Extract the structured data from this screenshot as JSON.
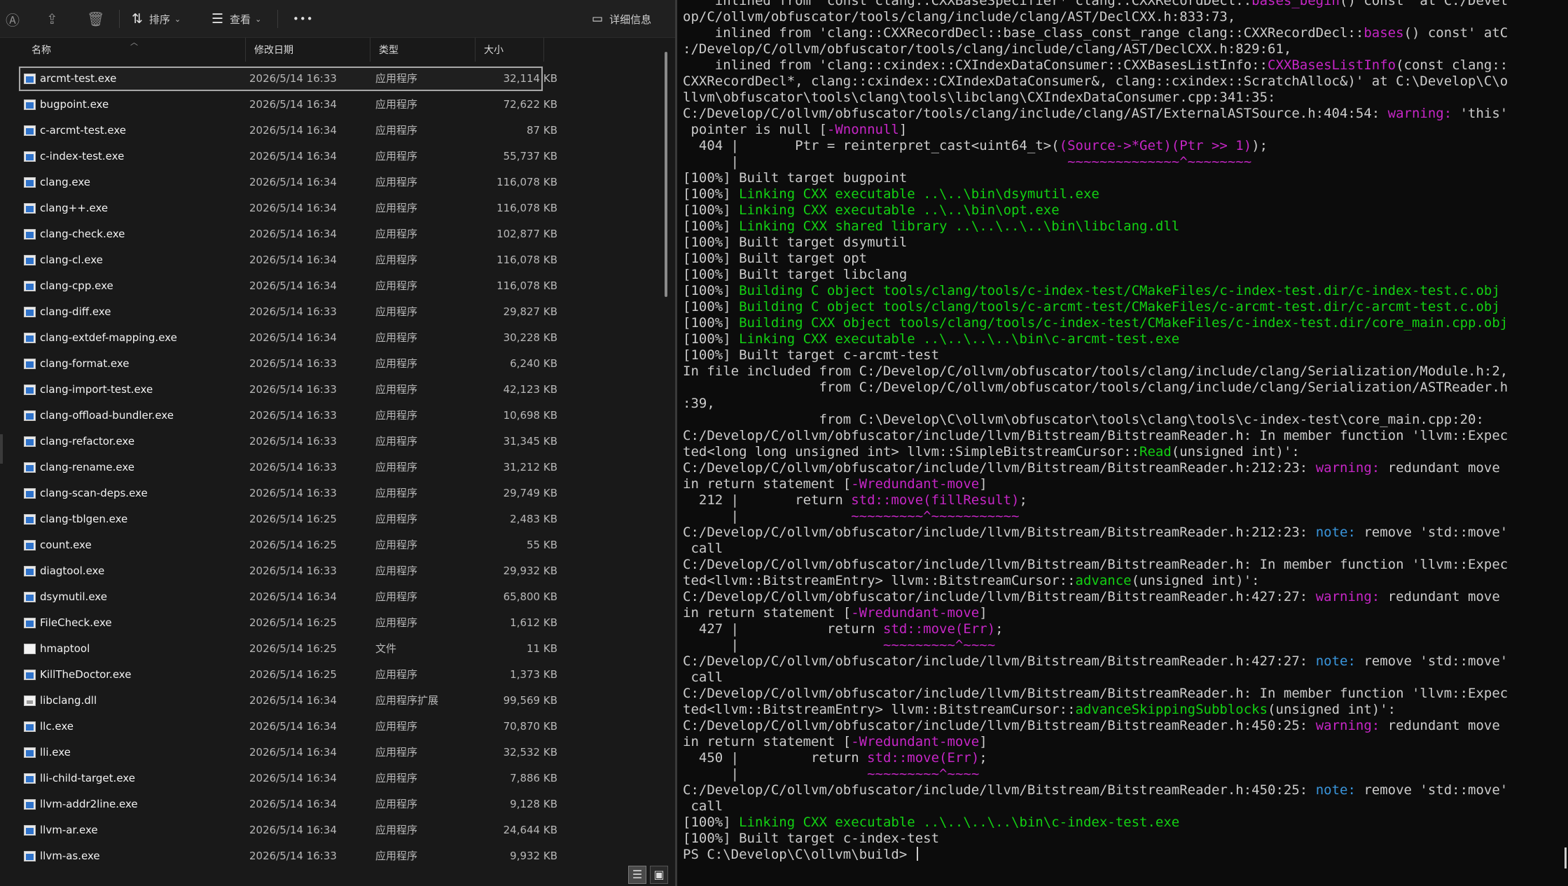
{
  "explorer": {
    "toolbar": {
      "sort_label": "排序",
      "view_label": "查看",
      "more_label": "•••",
      "details_label": "详细信息"
    },
    "columns": {
      "name": "名称",
      "modified": "修改日期",
      "type": "类型",
      "size": "大小"
    },
    "files": [
      {
        "name": "arcmt-test.exe",
        "date": "2026/5/14 16:33",
        "type": "应用程序",
        "size": "32,114 KB",
        "icon": "exe-icon",
        "selected": true
      },
      {
        "name": "bugpoint.exe",
        "date": "2026/5/14 16:34",
        "type": "应用程序",
        "size": "72,622 KB",
        "icon": "exe-icon"
      },
      {
        "name": "c-arcmt-test.exe",
        "date": "2026/5/14 16:34",
        "type": "应用程序",
        "size": "87 KB",
        "icon": "exe-icon"
      },
      {
        "name": "c-index-test.exe",
        "date": "2026/5/14 16:34",
        "type": "应用程序",
        "size": "55,737 KB",
        "icon": "exe-icon"
      },
      {
        "name": "clang.exe",
        "date": "2026/5/14 16:34",
        "type": "应用程序",
        "size": "116,078 KB",
        "icon": "exe-icon"
      },
      {
        "name": "clang++.exe",
        "date": "2026/5/14 16:34",
        "type": "应用程序",
        "size": "116,078 KB",
        "icon": "exe-icon"
      },
      {
        "name": "clang-check.exe",
        "date": "2026/5/14 16:34",
        "type": "应用程序",
        "size": "102,877 KB",
        "icon": "exe-icon"
      },
      {
        "name": "clang-cl.exe",
        "date": "2026/5/14 16:34",
        "type": "应用程序",
        "size": "116,078 KB",
        "icon": "exe-icon"
      },
      {
        "name": "clang-cpp.exe",
        "date": "2026/5/14 16:34",
        "type": "应用程序",
        "size": "116,078 KB",
        "icon": "exe-icon"
      },
      {
        "name": "clang-diff.exe",
        "date": "2026/5/14 16:33",
        "type": "应用程序",
        "size": "29,827 KB",
        "icon": "exe-icon"
      },
      {
        "name": "clang-extdef-mapping.exe",
        "date": "2026/5/14 16:34",
        "type": "应用程序",
        "size": "30,228 KB",
        "icon": "exe-icon"
      },
      {
        "name": "clang-format.exe",
        "date": "2026/5/14 16:33",
        "type": "应用程序",
        "size": "6,240 KB",
        "icon": "exe-icon"
      },
      {
        "name": "clang-import-test.exe",
        "date": "2026/5/14 16:33",
        "type": "应用程序",
        "size": "42,123 KB",
        "icon": "exe-icon"
      },
      {
        "name": "clang-offload-bundler.exe",
        "date": "2026/5/14 16:33",
        "type": "应用程序",
        "size": "10,698 KB",
        "icon": "exe-icon"
      },
      {
        "name": "clang-refactor.exe",
        "date": "2026/5/14 16:33",
        "type": "应用程序",
        "size": "31,345 KB",
        "icon": "exe-icon"
      },
      {
        "name": "clang-rename.exe",
        "date": "2026/5/14 16:33",
        "type": "应用程序",
        "size": "31,212 KB",
        "icon": "exe-icon"
      },
      {
        "name": "clang-scan-deps.exe",
        "date": "2026/5/14 16:33",
        "type": "应用程序",
        "size": "29,749 KB",
        "icon": "exe-icon"
      },
      {
        "name": "clang-tblgen.exe",
        "date": "2026/5/14 16:25",
        "type": "应用程序",
        "size": "2,483 KB",
        "icon": "exe-icon"
      },
      {
        "name": "count.exe",
        "date": "2026/5/14 16:25",
        "type": "应用程序",
        "size": "55 KB",
        "icon": "exe-icon"
      },
      {
        "name": "diagtool.exe",
        "date": "2026/5/14 16:33",
        "type": "应用程序",
        "size": "29,932 KB",
        "icon": "exe-icon"
      },
      {
        "name": "dsymutil.exe",
        "date": "2026/5/14 16:34",
        "type": "应用程序",
        "size": "65,800 KB",
        "icon": "exe-icon"
      },
      {
        "name": "FileCheck.exe",
        "date": "2026/5/14 16:25",
        "type": "应用程序",
        "size": "1,612 KB",
        "icon": "exe-icon"
      },
      {
        "name": "hmaptool",
        "date": "2026/5/14 16:25",
        "type": "文件",
        "size": "11 KB",
        "icon": "file-icon"
      },
      {
        "name": "KillTheDoctor.exe",
        "date": "2026/5/14 16:25",
        "type": "应用程序",
        "size": "1,373 KB",
        "icon": "exe-icon"
      },
      {
        "name": "libclang.dll",
        "date": "2026/5/14 16:34",
        "type": "应用程序扩展",
        "size": "99,569 KB",
        "icon": "dll-icon"
      },
      {
        "name": "llc.exe",
        "date": "2026/5/14 16:34",
        "type": "应用程序",
        "size": "70,870 KB",
        "icon": "exe-icon"
      },
      {
        "name": "lli.exe",
        "date": "2026/5/14 16:34",
        "type": "应用程序",
        "size": "32,532 KB",
        "icon": "exe-icon"
      },
      {
        "name": "lli-child-target.exe",
        "date": "2026/5/14 16:34",
        "type": "应用程序",
        "size": "7,886 KB",
        "icon": "exe-icon"
      },
      {
        "name": "llvm-addr2line.exe",
        "date": "2026/5/14 16:34",
        "type": "应用程序",
        "size": "9,128 KB",
        "icon": "exe-icon"
      },
      {
        "name": "llvm-ar.exe",
        "date": "2026/5/14 16:34",
        "type": "应用程序",
        "size": "24,644 KB",
        "icon": "exe-icon"
      },
      {
        "name": "llvm-as.exe",
        "date": "2026/5/14 16:33",
        "type": "应用程序",
        "size": "9,932 KB",
        "icon": "exe-icon"
      }
    ]
  },
  "terminal": {
    "colors": {
      "green": "#13d113",
      "magenta": "#c626c6",
      "cyan": "#3a96dd",
      "text": "#cccccc",
      "background": "#0c0c0c"
    },
    "lines": [
      [
        {
          "t": "    inlined from 'const clang::CXXBaseSpecifier* clang::CXXRecordDecl::"
        },
        {
          "t": "bases_begin",
          "c": "c-mag"
        },
        {
          "t": "() const' at C:/Devel"
        }
      ],
      [
        {
          "t": "op/C/ollvm/obfuscator/tools/clang/include/clang/AST/DeclCXX.h:833:73,"
        }
      ],
      [
        {
          "t": "    inlined from 'clang::CXXRecordDecl::base_class_const_range clang::CXXRecordDecl::"
        },
        {
          "t": "bases",
          "c": "c-mag"
        },
        {
          "t": "() const' atC"
        }
      ],
      [
        {
          "t": ":/Develop/C/ollvm/obfuscator/tools/clang/include/clang/AST/DeclCXX.h:829:61,"
        }
      ],
      [
        {
          "t": "    inlined from 'clang::cxindex::CXIndexDataConsumer::CXXBasesListInfo::"
        },
        {
          "t": "CXXBasesListInfo",
          "c": "c-mag"
        },
        {
          "t": "(const clang::"
        }
      ],
      [
        {
          "t": "CXXRecordDecl*, clang::cxindex::CXIndexDataConsumer&, clang::cxindex::ScratchAlloc&)' at C:\\Develop\\C\\o"
        }
      ],
      [
        {
          "t": "llvm\\obfuscator\\tools\\clang\\tools\\libclang\\CXIndexDataConsumer.cpp:341:35:"
        }
      ],
      [
        {
          "t": "C:/Develop/C/ollvm/obfuscator/tools/clang/include/clang/AST/ExternalASTSource.h:404:54: "
        },
        {
          "t": "warning:",
          "c": "c-mag"
        },
        {
          "t": " 'this'"
        }
      ],
      [
        {
          "t": " pointer is null ["
        },
        {
          "t": "-Wnonnull",
          "c": "c-mag"
        },
        {
          "t": "]"
        }
      ],
      [
        {
          "t": "  404 |       Ptr = reinterpret_cast<uint64_t>("
        },
        {
          "t": "(Source->*Get)(Ptr >> 1)",
          "c": "c-mag"
        },
        {
          "t": ");"
        }
      ],
      [
        {
          "t": "      |                                         "
        },
        {
          "t": "~~~~~~~~~~~~~~^~~~~~~~~",
          "c": "c-mag"
        }
      ],
      [
        {
          "t": "[100%] Built target bugpoint"
        }
      ],
      [
        {
          "t": "[100%] "
        },
        {
          "t": "Linking CXX executable ..\\..\\bin\\dsymutil.exe",
          "c": "c-green"
        }
      ],
      [
        {
          "t": "[100%] "
        },
        {
          "t": "Linking CXX executable ..\\..\\bin\\opt.exe",
          "c": "c-green"
        }
      ],
      [
        {
          "t": "[100%] "
        },
        {
          "t": "Linking CXX shared library ..\\..\\..\\..\\bin\\libclang.dll",
          "c": "c-green"
        }
      ],
      [
        {
          "t": "[100%] Built target dsymutil"
        }
      ],
      [
        {
          "t": "[100%] Built target opt"
        }
      ],
      [
        {
          "t": "[100%] Built target libclang"
        }
      ],
      [
        {
          "t": "[100%] "
        },
        {
          "t": "Building C object tools/clang/tools/c-index-test/CMakeFiles/c-index-test.dir/c-index-test.c.obj",
          "c": "c-green"
        }
      ],
      [
        {
          "t": "[100%] "
        },
        {
          "t": "Building C object tools/clang/tools/c-arcmt-test/CMakeFiles/c-arcmt-test.dir/c-arcmt-test.c.obj",
          "c": "c-green"
        }
      ],
      [
        {
          "t": "[100%] "
        },
        {
          "t": "Building CXX object tools/clang/tools/c-index-test/CMakeFiles/c-index-test.dir/core_main.cpp.obj",
          "c": "c-green"
        }
      ],
      [
        {
          "t": "[100%] "
        },
        {
          "t": "Linking CXX executable ..\\..\\..\\..\\bin\\c-arcmt-test.exe",
          "c": "c-green"
        }
      ],
      [
        {
          "t": "[100%] Built target c-arcmt-test"
        }
      ],
      [
        {
          "t": "In file included from C:/Develop/C/ollvm/obfuscator/tools/clang/include/clang/Serialization/Module.h:2,"
        }
      ],
      [
        {
          "t": "                 from C:/Develop/C/ollvm/obfuscator/tools/clang/include/clang/Serialization/ASTReader.h"
        }
      ],
      [
        {
          "t": ":39,"
        }
      ],
      [
        {
          "t": "                 from C:\\Develop\\C\\ollvm\\obfuscator\\tools\\clang\\tools\\c-index-test\\core_main.cpp:20:"
        }
      ],
      [
        {
          "t": "C:/Develop/C/ollvm/obfuscator/include/llvm/Bitstream/BitstreamReader.h: In member function 'llvm::Expec"
        }
      ],
      [
        {
          "t": "ted<long long unsigned int> llvm::SimpleBitstreamCursor::"
        },
        {
          "t": "Read",
          "c": "c-green"
        },
        {
          "t": "(unsigned int)':"
        }
      ],
      [
        {
          "t": "C:/Develop/C/ollvm/obfuscator/include/llvm/Bitstream/BitstreamReader.h:212:23: "
        },
        {
          "t": "warning:",
          "c": "c-mag"
        },
        {
          "t": " redundant move"
        }
      ],
      [
        {
          "t": "in return statement ["
        },
        {
          "t": "-Wredundant-move",
          "c": "c-mag"
        },
        {
          "t": "]"
        }
      ],
      [
        {
          "t": "  212 |       return "
        },
        {
          "t": "std::move(fillResult)",
          "c": "c-mag"
        },
        {
          "t": ";"
        }
      ],
      [
        {
          "t": "      |              "
        },
        {
          "t": "~~~~~~~~~^~~~~~~~~~~~",
          "c": "c-mag"
        }
      ],
      [
        {
          "t": "C:/Develop/C/ollvm/obfuscator/include/llvm/Bitstream/BitstreamReader.h:212:23: "
        },
        {
          "t": "note:",
          "c": "c-cyan"
        },
        {
          "t": " remove 'std::move'"
        }
      ],
      [
        {
          "t": " call"
        }
      ],
      [
        {
          "t": "C:/Develop/C/ollvm/obfuscator/include/llvm/Bitstream/BitstreamReader.h: In member function 'llvm::Expec"
        }
      ],
      [
        {
          "t": "ted<llvm::BitstreamEntry> llvm::BitstreamCursor::"
        },
        {
          "t": "advance",
          "c": "c-green"
        },
        {
          "t": "(unsigned int)':"
        }
      ],
      [
        {
          "t": "C:/Develop/C/ollvm/obfuscator/include/llvm/Bitstream/BitstreamReader.h:427:27: "
        },
        {
          "t": "warning:",
          "c": "c-mag"
        },
        {
          "t": " redundant move"
        }
      ],
      [
        {
          "t": "in return statement ["
        },
        {
          "t": "-Wredundant-move",
          "c": "c-mag"
        },
        {
          "t": "]"
        }
      ],
      [
        {
          "t": "  427 |           return "
        },
        {
          "t": "std::move(Err)",
          "c": "c-mag"
        },
        {
          "t": ";"
        }
      ],
      [
        {
          "t": "      |                  "
        },
        {
          "t": "~~~~~~~~~^~~~~",
          "c": "c-mag"
        }
      ],
      [
        {
          "t": "C:/Develop/C/ollvm/obfuscator/include/llvm/Bitstream/BitstreamReader.h:427:27: "
        },
        {
          "t": "note:",
          "c": "c-cyan"
        },
        {
          "t": " remove 'std::move'"
        }
      ],
      [
        {
          "t": " call"
        }
      ],
      [
        {
          "t": "C:/Develop/C/ollvm/obfuscator/include/llvm/Bitstream/BitstreamReader.h: In member function 'llvm::Expec"
        }
      ],
      [
        {
          "t": "ted<llvm::BitstreamEntry> llvm::BitstreamCursor::"
        },
        {
          "t": "advanceSkippingSubblocks",
          "c": "c-green"
        },
        {
          "t": "(unsigned int)':"
        }
      ],
      [
        {
          "t": "C:/Develop/C/ollvm/obfuscator/include/llvm/Bitstream/BitstreamReader.h:450:25: "
        },
        {
          "t": "warning:",
          "c": "c-mag"
        },
        {
          "t": " redundant move"
        }
      ],
      [
        {
          "t": "in return statement ["
        },
        {
          "t": "-Wredundant-move",
          "c": "c-mag"
        },
        {
          "t": "]"
        }
      ],
      [
        {
          "t": "  450 |         return "
        },
        {
          "t": "std::move(Err)",
          "c": "c-mag"
        },
        {
          "t": ";"
        }
      ],
      [
        {
          "t": "      |                "
        },
        {
          "t": "~~~~~~~~~^~~~~",
          "c": "c-mag"
        }
      ],
      [
        {
          "t": "C:/Develop/C/ollvm/obfuscator/include/llvm/Bitstream/BitstreamReader.h:450:25: "
        },
        {
          "t": "note:",
          "c": "c-cyan"
        },
        {
          "t": " remove 'std::move'"
        }
      ],
      [
        {
          "t": " call"
        }
      ],
      [
        {
          "t": "[100%] "
        },
        {
          "t": "Linking CXX executable ..\\..\\..\\..\\bin\\c-index-test.exe",
          "c": "c-green"
        }
      ],
      [
        {
          "t": "[100%] Built target c-index-test"
        }
      ],
      [
        {
          "t": "PS C:\\Develop\\C\\ollvm\\build> "
        }
      ]
    ]
  }
}
